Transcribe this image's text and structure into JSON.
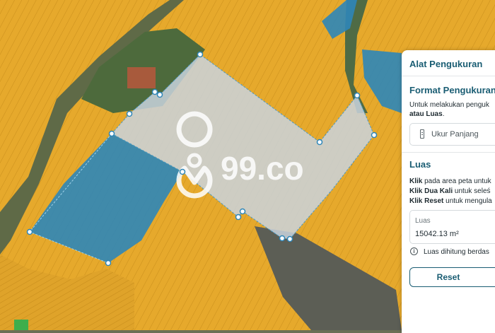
{
  "map": {
    "watermark": "99.co",
    "colors": {
      "parcel": "#e8a82c",
      "selected_parcel": "#2e86b8",
      "measure_fill": "#c9d4de",
      "vertex": "#ffffff",
      "vertex_stroke": "#2e86b8"
    }
  },
  "panel": {
    "title": "Alat Pengukuran",
    "format_heading": "Format Pengukuran",
    "format_desc_1": "Untuk melakukan penguk",
    "format_desc_2_bold": "atau Luas",
    "format_desc_2_tail": ".",
    "dropdown_label": "Ukur Panjang",
    "dropdown_icon": "ruler-icon",
    "area_heading": "Luas",
    "instr1_bold": "Klik",
    "instr1_rest": " pada area peta untuk",
    "instr2_bold": "Klik Dua Kali",
    "instr2_rest": " untuk seleś",
    "instr3_bold": "Klik Reset",
    "instr3_rest": " untuk mengula",
    "area_box_label": "Luas",
    "area_value": "15042.13 m²",
    "info_icon": "info-icon",
    "info_text": "Luas dihitung berdas",
    "reset_label": "Reset"
  }
}
